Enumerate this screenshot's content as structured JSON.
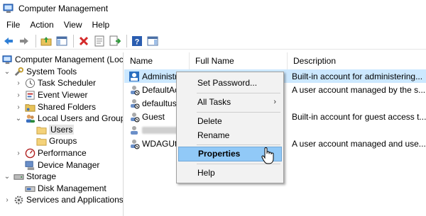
{
  "window": {
    "title": "Computer Management"
  },
  "menu": [
    "File",
    "Action",
    "View",
    "Help"
  ],
  "toolbar": {
    "buttons": [
      "back-arrow-icon",
      "forward-arrow-icon",
      "up-folder-icon",
      "show-hide-tree-icon",
      "delete-icon",
      "properties-icon",
      "export-list-icon",
      "help-icon",
      "action-pane-icon"
    ]
  },
  "tree": {
    "items": [
      {
        "label": "Computer Management (Local",
        "icon": "computer-management-icon",
        "twisty": ""
      },
      {
        "label": "System Tools",
        "icon": "system-tools-icon",
        "twisty": "⌄"
      },
      {
        "label": "Task Scheduler",
        "icon": "clock-icon",
        "twisty": "›"
      },
      {
        "label": "Event Viewer",
        "icon": "event-viewer-icon",
        "twisty": "›"
      },
      {
        "label": "Shared Folders",
        "icon": "shared-folder-icon",
        "twisty": "›"
      },
      {
        "label": "Local Users and Groups",
        "icon": "users-groups-icon",
        "twisty": "⌄"
      },
      {
        "label": "Users",
        "icon": "folder-icon",
        "twisty": ""
      },
      {
        "label": "Groups",
        "icon": "folder-icon",
        "twisty": ""
      },
      {
        "label": "Performance",
        "icon": "performance-icon",
        "twisty": "›"
      },
      {
        "label": "Device Manager",
        "icon": "device-manager-icon",
        "twisty": ""
      },
      {
        "label": "Storage",
        "icon": "storage-icon",
        "twisty": "⌄"
      },
      {
        "label": "Disk Management",
        "icon": "disk-management-icon",
        "twisty": ""
      },
      {
        "label": "Services and Applications",
        "icon": "services-icon",
        "twisty": "›"
      }
    ]
  },
  "list": {
    "columns": [
      "Name",
      "Full Name",
      "Description"
    ],
    "rows": [
      {
        "name": "Administrat",
        "full_name": "",
        "description": "Built-in account for administering..."
      },
      {
        "name": "DefaultAc",
        "full_name": "",
        "description": "A user account managed by the s..."
      },
      {
        "name": "defaultuse",
        "full_name": "",
        "description": ""
      },
      {
        "name": "Guest",
        "full_name": "",
        "description": "Built-in account for guest access t..."
      },
      {
        "name": "",
        "full_name": "",
        "description": ""
      },
      {
        "name": "WDAGUtili",
        "full_name": "",
        "description": "A user account managed and use..."
      }
    ]
  },
  "context_menu": {
    "items": [
      "Set Password...",
      "All Tasks",
      "Delete",
      "Rename",
      "Properties",
      "Help"
    ],
    "submenu_arrow": "›"
  },
  "colors": {
    "selection": "#cce8ff",
    "menu_highlight": "#91c9f7"
  }
}
